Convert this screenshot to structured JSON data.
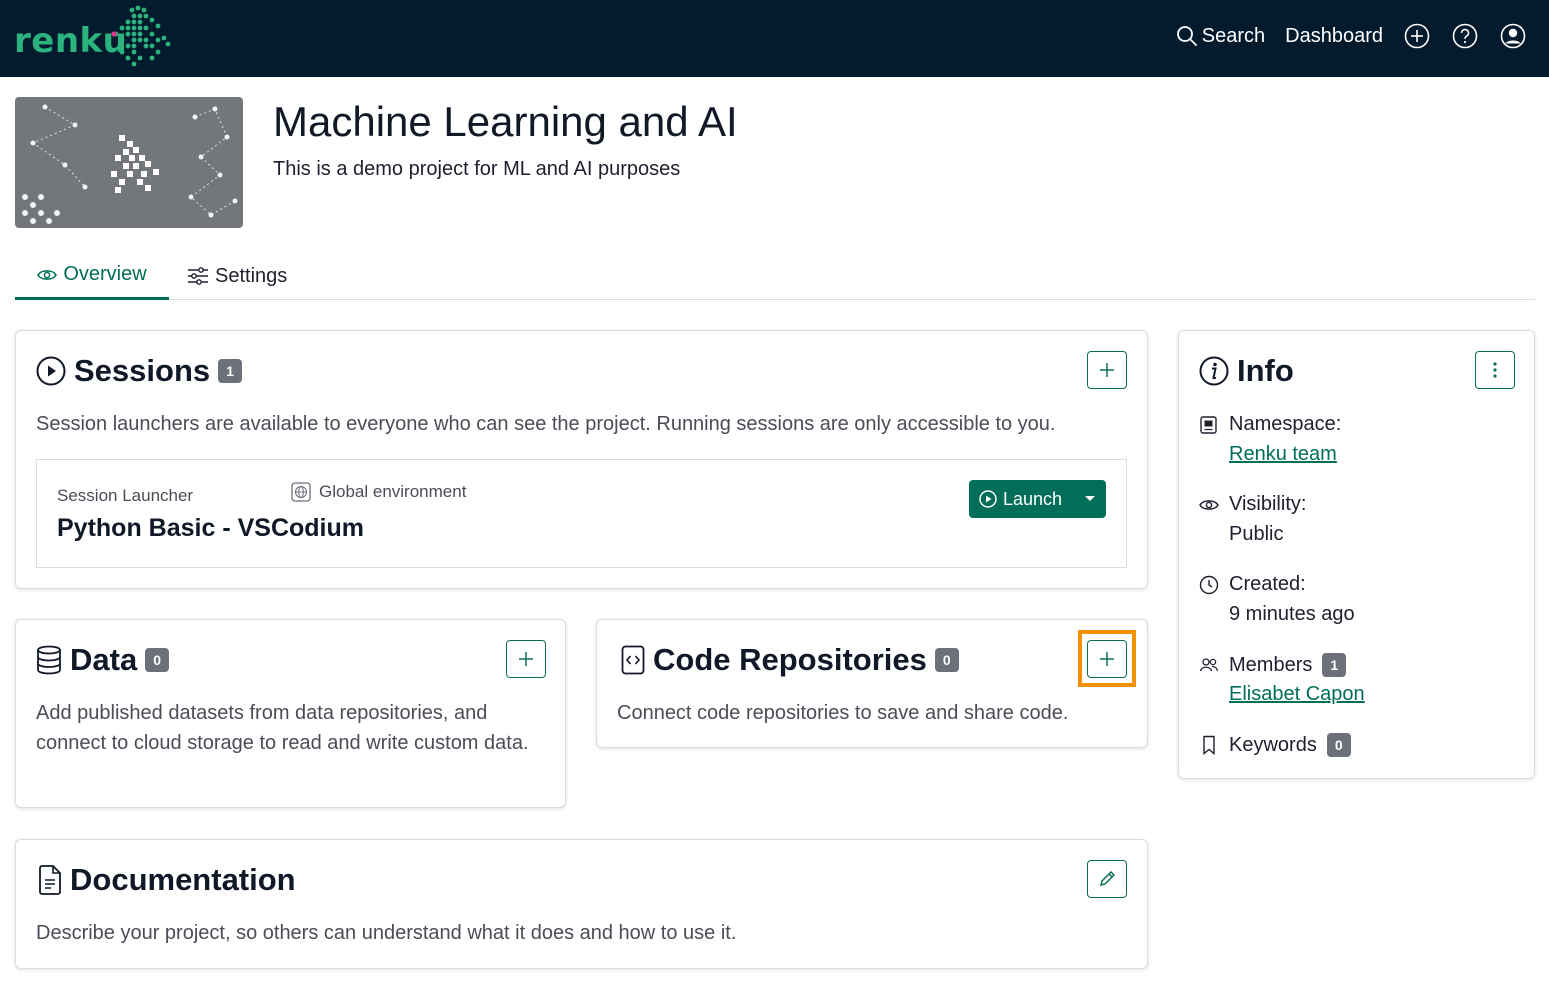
{
  "navbar": {
    "logo_text": "renku",
    "search_label": "Search",
    "dashboard_label": "Dashboard"
  },
  "project": {
    "title": "Machine Learning and AI",
    "description": "This is a demo project for ML and AI purposes"
  },
  "tabs": [
    {
      "label": "Overview",
      "active": true
    },
    {
      "label": "Settings",
      "active": false
    }
  ],
  "sessions": {
    "title": "Sessions",
    "count": "1",
    "description": "Session launchers are available to everyone who can see the project. Running sessions are only accessible to you.",
    "launcher": {
      "label": "Session Launcher",
      "environment": "Global environment",
      "name": "Python Basic - VSCodium",
      "launch_label": "Launch"
    }
  },
  "data_card": {
    "title": "Data",
    "count": "0",
    "description": "Add published datasets from data repositories, and connect to cloud storage to read and write custom data."
  },
  "code_repos": {
    "title": "Code Repositories",
    "count": "0",
    "description": "Connect code repositories to save and share code."
  },
  "documentation": {
    "title": "Documentation",
    "description": "Describe your project, so others can understand what it does and how to use it."
  },
  "info": {
    "title": "Info",
    "namespace_label": "Namespace:",
    "namespace_value": "Renku team",
    "visibility_label": "Visibility:",
    "visibility_value": "Public",
    "created_label": "Created:",
    "created_value": "9 minutes ago",
    "members_label": "Members",
    "members_count": "1",
    "members_value": "Elisabet Capon",
    "keywords_label": "Keywords",
    "keywords_count": "0"
  },
  "colors": {
    "navbar_bg": "#041b2d",
    "brand_green": "#2ab37d",
    "accent": "#006e58",
    "highlight": "#f39200",
    "badge_bg": "#6c7079"
  },
  "icons": {
    "search": "search-icon",
    "add": "plus-circle-icon",
    "help": "question-circle-icon",
    "user": "user-circle-icon"
  }
}
